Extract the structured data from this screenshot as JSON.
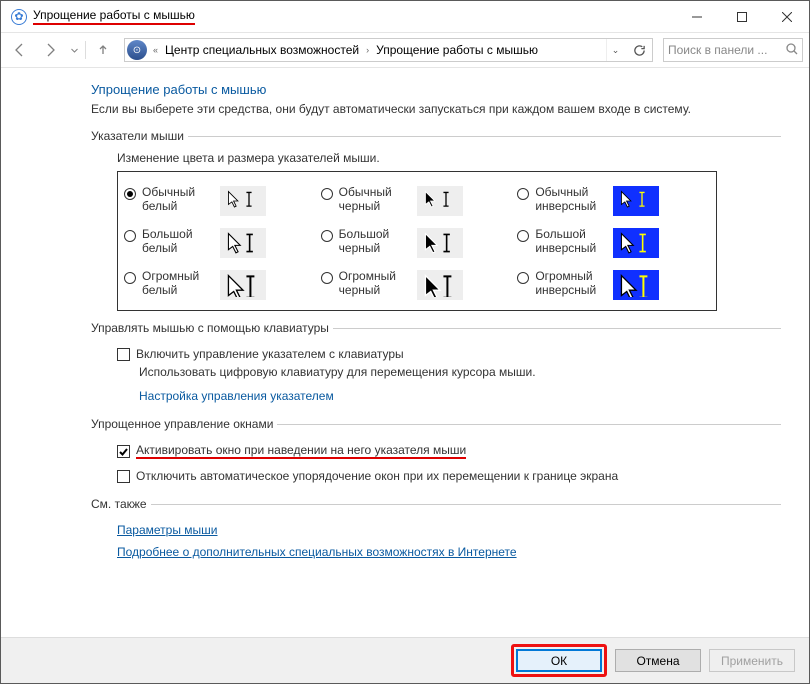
{
  "title": "Упрощение работы с мышью",
  "breadcrumb": {
    "chevrons": "«",
    "a": "Центр специальных возможностей",
    "b": "Упрощение работы с мышью"
  },
  "search": {
    "placeholder": "Поиск в панели ..."
  },
  "heading": "Упрощение работы с мышью",
  "intro": "Если вы выберете эти средства, они будут автоматически запускаться при каждом вашем входе в систему.",
  "pointers": {
    "legend": "Указатели мыши",
    "caption": "Изменение цвета и размера указателей мыши.",
    "items": [
      [
        {
          "label_a": "Обычный",
          "label_b": "белый",
          "selected": true,
          "variant": "white"
        },
        {
          "label_a": "Обычный",
          "label_b": "черный",
          "selected": false,
          "variant": "black"
        },
        {
          "label_a": "Обычный",
          "label_b": "инверсный",
          "selected": false,
          "variant": "inverse"
        }
      ],
      [
        {
          "label_a": "Большой",
          "label_b": "белый",
          "selected": false,
          "variant": "white"
        },
        {
          "label_a": "Большой",
          "label_b": "черный",
          "selected": false,
          "variant": "black"
        },
        {
          "label_a": "Большой",
          "label_b": "инверсный",
          "selected": false,
          "variant": "inverse"
        }
      ],
      [
        {
          "label_a": "Огромный",
          "label_b": "белый",
          "selected": false,
          "variant": "white"
        },
        {
          "label_a": "Огромный",
          "label_b": "черный",
          "selected": false,
          "variant": "black"
        },
        {
          "label_a": "Огромный",
          "label_b": "инверсный",
          "selected": false,
          "variant": "inverse"
        }
      ]
    ]
  },
  "keyboard": {
    "legend": "Управлять мышью с помощью клавиатуры",
    "enable": {
      "checked": false,
      "label": "Включить управление указателем с клавиатуры"
    },
    "note": "Использовать цифровую клавиатуру для перемещения курсора мыши.",
    "link": "Настройка управления указателем"
  },
  "windows": {
    "legend": "Упрощенное управление окнами",
    "activate": {
      "checked": true,
      "label": "Активировать окно при наведении на него указателя мыши"
    },
    "snap": {
      "checked": false,
      "label": "Отключить автоматическое упорядочение окон при их перемещении к границе экрана"
    }
  },
  "seealso": {
    "legend": "См. также",
    "a": "Параметры мыши",
    "b": "Подробнее о дополнительных специальных возможностях в Интернете"
  },
  "buttons": {
    "ok": "ОК",
    "cancel": "Отмена",
    "apply": "Применить"
  }
}
